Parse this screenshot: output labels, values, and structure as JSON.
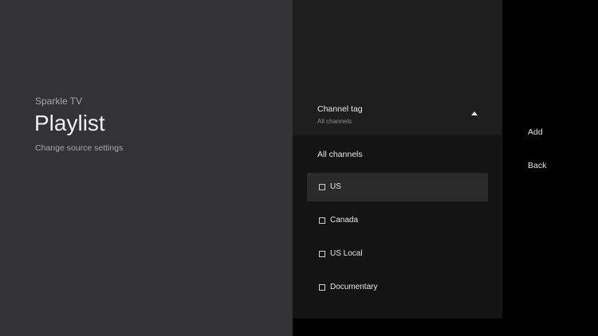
{
  "header": {
    "app_name": "Sparkle TV",
    "title": "Playlist",
    "subtitle": "Change source settings"
  },
  "channel_tag": {
    "label": "Channel tag",
    "value": "All channels",
    "expanded": true
  },
  "options": {
    "all_label": "All channels",
    "items": [
      {
        "label": "US",
        "checked": false,
        "focused": true
      },
      {
        "label": "Canada",
        "checked": false,
        "focused": false
      },
      {
        "label": "US Local",
        "checked": false,
        "focused": false
      },
      {
        "label": "Documentary",
        "checked": false,
        "focused": false
      }
    ]
  },
  "actions": {
    "add_label": "Add",
    "back_label": "Back"
  },
  "colors": {
    "left_panel": "#333335",
    "middle_top": "#1e1e1e",
    "middle_list": "#141414",
    "focus_highlight": "#2a2a2a",
    "background": "#000000"
  }
}
